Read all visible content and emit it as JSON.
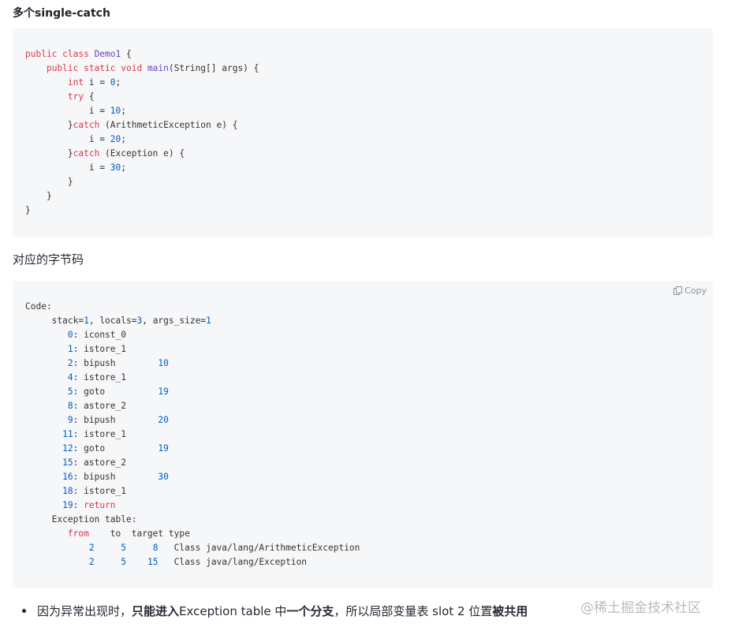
{
  "heading": "多个single-catch",
  "code1": {
    "lines": [
      [
        {
          "t": "public class ",
          "c": "kw"
        },
        {
          "t": "Demo1",
          "c": "fn"
        },
        {
          "t": " {",
          "c": ""
        }
      ],
      [
        {
          "t": "    ",
          "c": ""
        },
        {
          "t": "public static void ",
          "c": "kw"
        },
        {
          "t": "main",
          "c": "fn"
        },
        {
          "t": "(String[] args) {",
          "c": ""
        }
      ],
      [
        {
          "t": "        ",
          "c": ""
        },
        {
          "t": "int",
          "c": "kw"
        },
        {
          "t": " i = ",
          "c": ""
        },
        {
          "t": "0",
          "c": "num"
        },
        {
          "t": ";",
          "c": ""
        }
      ],
      [
        {
          "t": "        ",
          "c": ""
        },
        {
          "t": "try",
          "c": "kw"
        },
        {
          "t": " {",
          "c": ""
        }
      ],
      [
        {
          "t": "            i = ",
          "c": ""
        },
        {
          "t": "10",
          "c": "num"
        },
        {
          "t": ";",
          "c": ""
        }
      ],
      [
        {
          "t": "        }",
          "c": ""
        },
        {
          "t": "catch",
          "c": "kw"
        },
        {
          "t": " (ArithmeticException e) {",
          "c": ""
        }
      ],
      [
        {
          "t": "            i = ",
          "c": ""
        },
        {
          "t": "20",
          "c": "num"
        },
        {
          "t": ";",
          "c": ""
        }
      ],
      [
        {
          "t": "        }",
          "c": ""
        },
        {
          "t": "catch",
          "c": "kw"
        },
        {
          "t": " (Exception e) {",
          "c": ""
        }
      ],
      [
        {
          "t": "            i = ",
          "c": ""
        },
        {
          "t": "30",
          "c": "num"
        },
        {
          "t": ";",
          "c": ""
        }
      ],
      [
        {
          "t": "        }",
          "c": ""
        }
      ],
      [
        {
          "t": "    }",
          "c": ""
        }
      ],
      [
        {
          "t": "}",
          "c": ""
        }
      ]
    ]
  },
  "paragraph": "对应的字节码",
  "code2": {
    "copy_label": "Copy",
    "lines": [
      [
        {
          "t": "Code:",
          "c": ""
        }
      ],
      [
        {
          "t": "     stack=",
          "c": ""
        },
        {
          "t": "1",
          "c": "num"
        },
        {
          "t": ", locals=",
          "c": ""
        },
        {
          "t": "3",
          "c": "num"
        },
        {
          "t": ", args_size=",
          "c": ""
        },
        {
          "t": "1",
          "c": "num"
        }
      ],
      [
        {
          "t": "        ",
          "c": ""
        },
        {
          "t": "0",
          "c": "num"
        },
        {
          "t": ": iconst_0",
          "c": ""
        }
      ],
      [
        {
          "t": "        ",
          "c": ""
        },
        {
          "t": "1",
          "c": "num"
        },
        {
          "t": ": istore_1",
          "c": ""
        }
      ],
      [
        {
          "t": "        ",
          "c": ""
        },
        {
          "t": "2",
          "c": "num"
        },
        {
          "t": ": bipush        ",
          "c": ""
        },
        {
          "t": "10",
          "c": "num"
        }
      ],
      [
        {
          "t": "        ",
          "c": ""
        },
        {
          "t": "4",
          "c": "num"
        },
        {
          "t": ": istore_1",
          "c": ""
        }
      ],
      [
        {
          "t": "        ",
          "c": ""
        },
        {
          "t": "5",
          "c": "num"
        },
        {
          "t": ": goto          ",
          "c": ""
        },
        {
          "t": "19",
          "c": "num"
        }
      ],
      [
        {
          "t": "        ",
          "c": ""
        },
        {
          "t": "8",
          "c": "num"
        },
        {
          "t": ": astore_2",
          "c": ""
        }
      ],
      [
        {
          "t": "        ",
          "c": ""
        },
        {
          "t": "9",
          "c": "num"
        },
        {
          "t": ": bipush        ",
          "c": ""
        },
        {
          "t": "20",
          "c": "num"
        }
      ],
      [
        {
          "t": "       ",
          "c": ""
        },
        {
          "t": "11",
          "c": "num"
        },
        {
          "t": ": istore_1",
          "c": ""
        }
      ],
      [
        {
          "t": "       ",
          "c": ""
        },
        {
          "t": "12",
          "c": "num"
        },
        {
          "t": ": goto          ",
          "c": ""
        },
        {
          "t": "19",
          "c": "num"
        }
      ],
      [
        {
          "t": "       ",
          "c": ""
        },
        {
          "t": "15",
          "c": "num"
        },
        {
          "t": ": astore_2",
          "c": ""
        }
      ],
      [
        {
          "t": "       ",
          "c": ""
        },
        {
          "t": "16",
          "c": "num"
        },
        {
          "t": ": bipush        ",
          "c": ""
        },
        {
          "t": "30",
          "c": "num"
        }
      ],
      [
        {
          "t": "       ",
          "c": ""
        },
        {
          "t": "18",
          "c": "num"
        },
        {
          "t": ": istore_1",
          "c": ""
        }
      ],
      [
        {
          "t": "       ",
          "c": ""
        },
        {
          "t": "19",
          "c": "num"
        },
        {
          "t": ": ",
          "c": ""
        },
        {
          "t": "return",
          "c": "kw"
        }
      ],
      [
        {
          "t": "     Exception table:",
          "c": ""
        }
      ],
      [
        {
          "t": "        ",
          "c": ""
        },
        {
          "t": "from",
          "c": "kw"
        },
        {
          "t": "    to  target type",
          "c": ""
        }
      ],
      [
        {
          "t": "            ",
          "c": ""
        },
        {
          "t": "2",
          "c": "num"
        },
        {
          "t": "     ",
          "c": ""
        },
        {
          "t": "5",
          "c": "num"
        },
        {
          "t": "     ",
          "c": ""
        },
        {
          "t": "8",
          "c": "num"
        },
        {
          "t": "   Class java/lang/ArithmeticException",
          "c": ""
        }
      ],
      [
        {
          "t": "            ",
          "c": ""
        },
        {
          "t": "2",
          "c": "num"
        },
        {
          "t": "     ",
          "c": ""
        },
        {
          "t": "5",
          "c": "num"
        },
        {
          "t": "    ",
          "c": ""
        },
        {
          "t": "15",
          "c": "num"
        },
        {
          "t": "   Class java/lang/Exception",
          "c": ""
        }
      ]
    ]
  },
  "bullet": {
    "p1": "因为异常出现时，",
    "b1": "只能进入",
    "p2": " Exception table 中",
    "b2": "一个分支",
    "p3": "，所以局部变量表 slot 2 位置",
    "b3": "被共用"
  },
  "watermark": "@稀土掘金技术社区",
  "colors": {
    "keyword": "#d73a49",
    "function": "#6f42c1",
    "number": "#005cc5",
    "code_bg": "#f6f7f9"
  }
}
